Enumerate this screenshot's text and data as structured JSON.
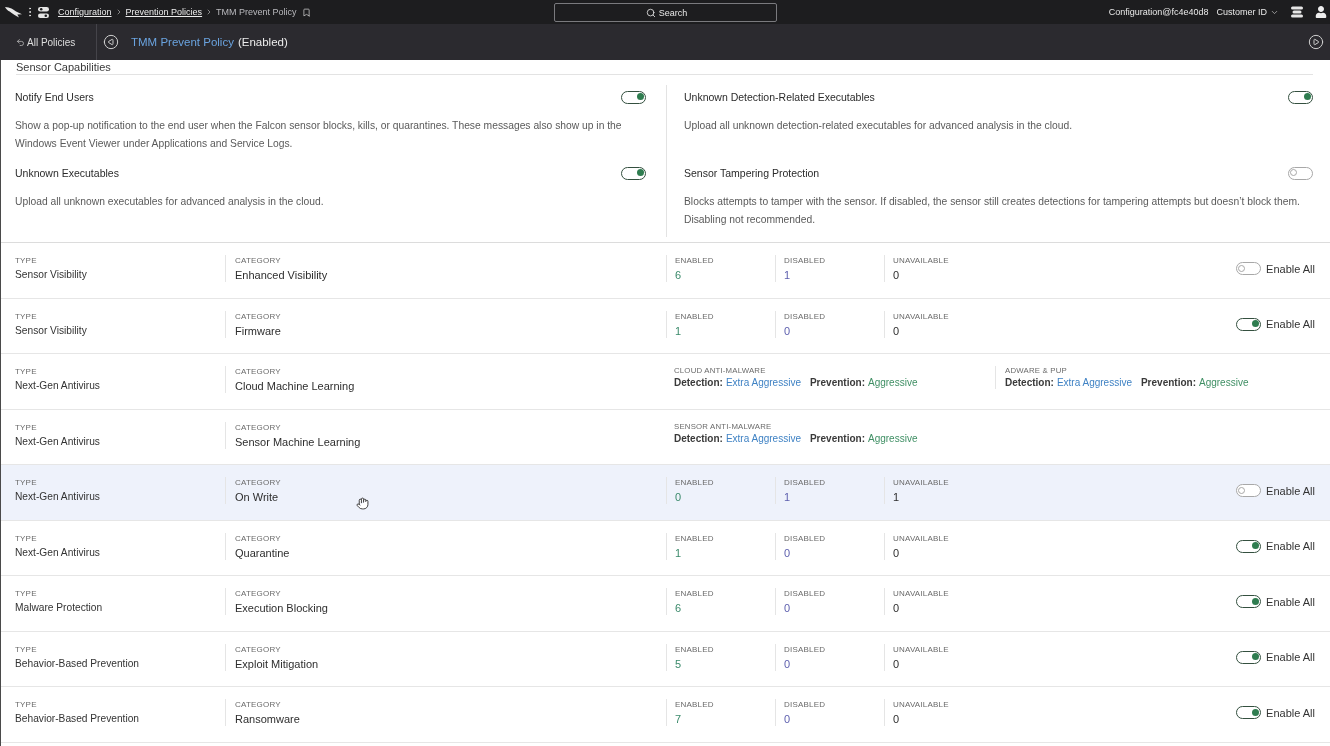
{
  "top_bar": {
    "breadcrumbs": [
      {
        "label": "Configuration",
        "link": true
      },
      {
        "label": "Prevention Policies",
        "link": true
      },
      {
        "label": "TMM Prevent Policy",
        "link": false
      }
    ],
    "search": {
      "placeholder": "Search"
    },
    "account": "Configuration@fc4e40d8",
    "customer_menu": "Customer ID"
  },
  "policy_bar": {
    "back_label": "All Policies",
    "policy_name": "TMM Prevent Policy",
    "policy_status": "(Enabled)"
  },
  "capabilities": {
    "heading": "Sensor Capabilities",
    "items": [
      {
        "title": "Notify End Users",
        "on": true,
        "description": "Show a pop-up notification to the end user when the Falcon sensor blocks, kills, or quarantines. These messages also show up in the Windows Event Viewer under Applications and Service Logs."
      },
      {
        "title": "Unknown Detection-Related Executables",
        "on": true,
        "description": "Upload all unknown detection-related executables for advanced analysis in the cloud."
      },
      {
        "title": "Unknown Executables",
        "on": true,
        "description": "Upload all unknown executables for advanced analysis in the cloud."
      },
      {
        "title": "Sensor Tampering Protection",
        "on": false,
        "description": "Blocks attempts to tamper with the sensor. If disabled, the sensor still creates detections for tampering attempts but doesn’t block them. Disabling not recommended."
      }
    ]
  },
  "rows": [
    {
      "kind": "counts",
      "hovered": false,
      "type_label": "TYPE",
      "type": "Sensor Visibility",
      "category_label": "CATEGORY",
      "category": "Enhanced Visibility",
      "counts": [
        {
          "label": "ENABLED",
          "value": "6"
        },
        {
          "label": "DISABLED",
          "value": "1"
        },
        {
          "label": "UNAVAILABLE",
          "value": "0"
        }
      ],
      "enable_all": {
        "label": "Enable All",
        "on": false
      }
    },
    {
      "kind": "counts",
      "hovered": false,
      "type_label": "TYPE",
      "type": "Sensor Visibility",
      "category_label": "CATEGORY",
      "category": "Firmware",
      "counts": [
        {
          "label": "ENABLED",
          "value": "1"
        },
        {
          "label": "DISABLED",
          "value": "0"
        },
        {
          "label": "UNAVAILABLE",
          "value": "0"
        }
      ],
      "enable_all": {
        "label": "Enable All",
        "on": true
      }
    },
    {
      "kind": "ml",
      "hovered": false,
      "type_label": "TYPE",
      "type": "Next-Gen Antivirus",
      "category_label": "CATEGORY",
      "category": "Cloud Machine Learning",
      "groups": [
        {
          "label": "CLOUD ANTI-MALWARE",
          "detection_label": "Detection:",
          "detection": "Extra Aggressive",
          "prevention_label": "Prevention:",
          "prevention": "Aggressive"
        },
        {
          "label": "ADWARE & PUP",
          "detection_label": "Detection:",
          "detection": "Extra Aggressive",
          "prevention_label": "Prevention:",
          "prevention": "Aggressive"
        }
      ]
    },
    {
      "kind": "ml",
      "hovered": false,
      "type_label": "TYPE",
      "type": "Next-Gen Antivirus",
      "category_label": "CATEGORY",
      "category": "Sensor Machine Learning",
      "groups": [
        {
          "label": "SENSOR ANTI-MALWARE",
          "detection_label": "Detection:",
          "detection": "Extra Aggressive",
          "prevention_label": "Prevention:",
          "prevention": "Aggressive"
        }
      ]
    },
    {
      "kind": "counts",
      "hovered": true,
      "type_label": "TYPE",
      "type": "Next-Gen Antivirus",
      "category_label": "CATEGORY",
      "category": "On Write",
      "counts": [
        {
          "label": "ENABLED",
          "value": "0"
        },
        {
          "label": "DISABLED",
          "value": "1"
        },
        {
          "label": "UNAVAILABLE",
          "value": "1"
        }
      ],
      "enable_all": {
        "label": "Enable All",
        "on": false
      }
    },
    {
      "kind": "counts",
      "hovered": false,
      "type_label": "TYPE",
      "type": "Next-Gen Antivirus",
      "category_label": "CATEGORY",
      "category": "Quarantine",
      "counts": [
        {
          "label": "ENABLED",
          "value": "1"
        },
        {
          "label": "DISABLED",
          "value": "0"
        },
        {
          "label": "UNAVAILABLE",
          "value": "0"
        }
      ],
      "enable_all": {
        "label": "Enable All",
        "on": true
      }
    },
    {
      "kind": "counts",
      "hovered": false,
      "type_label": "TYPE",
      "type": "Malware Protection",
      "category_label": "CATEGORY",
      "category": "Execution Blocking",
      "counts": [
        {
          "label": "ENABLED",
          "value": "6"
        },
        {
          "label": "DISABLED",
          "value": "0"
        },
        {
          "label": "UNAVAILABLE",
          "value": "0"
        }
      ],
      "enable_all": {
        "label": "Enable All",
        "on": true
      }
    },
    {
      "kind": "counts",
      "hovered": false,
      "type_label": "TYPE",
      "type": "Behavior-Based Prevention",
      "category_label": "CATEGORY",
      "category": "Exploit Mitigation",
      "counts": [
        {
          "label": "ENABLED",
          "value": "5"
        },
        {
          "label": "DISABLED",
          "value": "0"
        },
        {
          "label": "UNAVAILABLE",
          "value": "0"
        }
      ],
      "enable_all": {
        "label": "Enable All",
        "on": true
      }
    },
    {
      "kind": "counts",
      "hovered": false,
      "type_label": "TYPE",
      "type": "Behavior-Based Prevention",
      "category_label": "CATEGORY",
      "category": "Ransomware",
      "counts": [
        {
          "label": "ENABLED",
          "value": "7"
        },
        {
          "label": "DISABLED",
          "value": "0"
        },
        {
          "label": "UNAVAILABLE",
          "value": "0"
        }
      ],
      "enable_all": {
        "label": "Enable All",
        "on": true
      }
    }
  ]
}
